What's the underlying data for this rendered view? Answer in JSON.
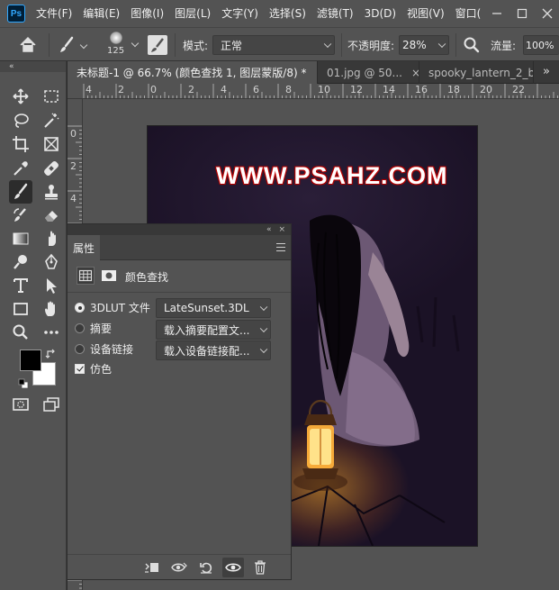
{
  "menubar": {
    "logo": "Ps",
    "items": [
      "文件(F)",
      "编辑(E)",
      "图像(I)",
      "图层(L)",
      "文字(Y)",
      "选择(S)",
      "滤镜(T)",
      "3D(D)",
      "视图(V)",
      "窗口("
    ]
  },
  "options": {
    "brush_size": "125",
    "mode_label": "模式:",
    "mode_value": "正常",
    "opacity_label": "不透明度:",
    "opacity_value": "28%",
    "flow_label": "流量:",
    "flow_value": "100%"
  },
  "tabs": [
    {
      "label": "未标题-1 @ 66.7% (颜色查找 1, 图层蒙版/8) *",
      "close": "×"
    },
    {
      "label": "01.jpg @ 50...",
      "close": "×"
    },
    {
      "label": "spooky_lantern_2_b"
    }
  ],
  "tabs_overflow": "»",
  "toolbar_collapse": "«",
  "ruler": {
    "top": [
      "4",
      "2",
      "0",
      "2",
      "4",
      "6",
      "8",
      "10",
      "12",
      "14",
      "16",
      "18",
      "20",
      "22"
    ],
    "left": [
      "0",
      "2",
      "4"
    ]
  },
  "canvas": {
    "watermark": "WWW.PSAHZ.COM"
  },
  "properties": {
    "tab_label": "属性",
    "collapse": "«",
    "close": "×",
    "adjustment_name": "颜色查找",
    "options": [
      {
        "label": "3DLUT 文件",
        "selected": true,
        "value": "LateSunset.3DL"
      },
      {
        "label": "摘要",
        "selected": false,
        "value": "载入摘要配置文..."
      },
      {
        "label": "设备链接",
        "selected": false,
        "value": "载入设备链接配..."
      }
    ],
    "dither_label": "仿色",
    "dither_checked": true
  },
  "colors": {
    "foreground": "#000000",
    "background": "#ffffff",
    "accent": "#31a8ff"
  }
}
